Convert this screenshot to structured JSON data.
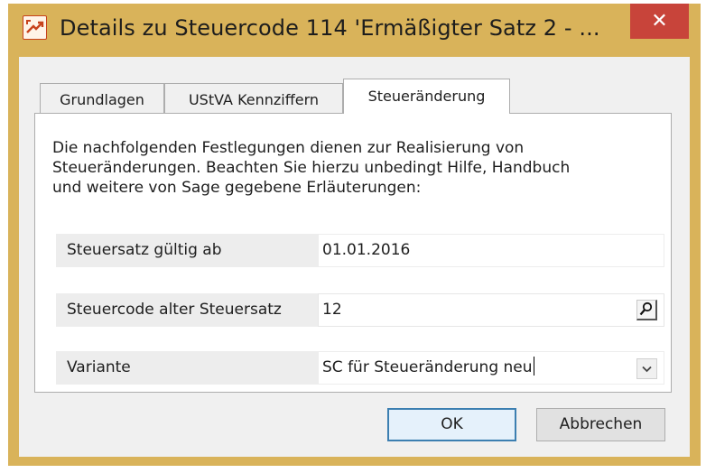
{
  "window": {
    "title": "Details zu Steuercode 114 'Ermäßigter Satz 2 - ...",
    "close_label": "✕"
  },
  "tabs": [
    {
      "label": "Grundlagen",
      "active": false
    },
    {
      "label": "UStVA Kennziffern",
      "active": false
    },
    {
      "label": "Steueränderung",
      "active": true
    }
  ],
  "panel": {
    "intro_lines": [
      "Die nachfolgenden Festlegungen dienen zur Realisierung von",
      "Steueränderungen. Beachten Sie hierzu unbedingt Hilfe, Handbuch",
      "und weitere von Sage gegebene Erläuterungen:"
    ],
    "fields": {
      "valid_from": {
        "label": "Steuersatz gültig ab",
        "value": "01.01.2016"
      },
      "old_code": {
        "label": "Steuercode alter Steuersatz",
        "value": "12"
      },
      "variant": {
        "label": "Variante",
        "value": "SC für Steueränderung neu"
      }
    }
  },
  "buttons": {
    "ok": "OK",
    "cancel": "Abbrechen"
  },
  "icons": {
    "app": "sage-app-icon",
    "lookup": "magnifier-icon",
    "dropdown": "chevron-down-icon",
    "close": "close-icon"
  },
  "colors": {
    "title_bar": "#d9b35a",
    "close_button": "#c8443a",
    "default_button_border": "#3c7fb1"
  }
}
